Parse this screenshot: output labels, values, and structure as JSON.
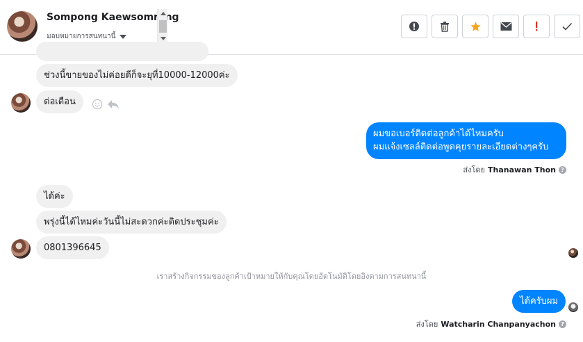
{
  "header": {
    "contact_name": "Sompong Kaewsomrong",
    "assign_label": "มอบหมายการสนทนานี้"
  },
  "actions": [
    {
      "name": "report-icon",
      "color": "#444950"
    },
    {
      "name": "trash-icon",
      "color": "#444950"
    },
    {
      "name": "star-icon",
      "color": "#f5a623"
    },
    {
      "name": "mail-icon",
      "color": "#444950"
    },
    {
      "name": "exclamation-icon",
      "color": "#d93025"
    },
    {
      "name": "check-icon",
      "color": "#444950"
    }
  ],
  "messages": {
    "m1": "ช่วงนี้ขายของไม่ค่อยดีก็จะยุที่10000-12000ค่ะ",
    "m2": "ต่อเดือน",
    "m3_line1": "ผมขอเบอร์ติดต่อลูกค้าได้ไหมครับ",
    "m3_line2": "ผมแจ้งเซลล์ติดต่อพูดคุยรายละเอียดต่างๆครับ",
    "m4": "ได้ค่ะ",
    "m5": "พรุ่งนี้ได้ไหมค่ะวันนี้ไม่สะดวกค่ะติดประชุมค่ะ",
    "m6": "0801396645",
    "m7": "ได้ครับผม"
  },
  "sent_by_1": {
    "prefix": "ส่งโดย",
    "name": "Thanawan Thon"
  },
  "sent_by_2": {
    "prefix": "ส่งโดย",
    "name": "Watcharin Chanpanyachon"
  },
  "system_note": "เราสร้างกิจกรรมของลูกค้าเป้าหมายให้กับคุณโดยอัตโนมัติโดยอิงตามการสนทนานี้",
  "colors": {
    "outgoing": "#0084ff",
    "incoming": "#f1f0f0"
  }
}
